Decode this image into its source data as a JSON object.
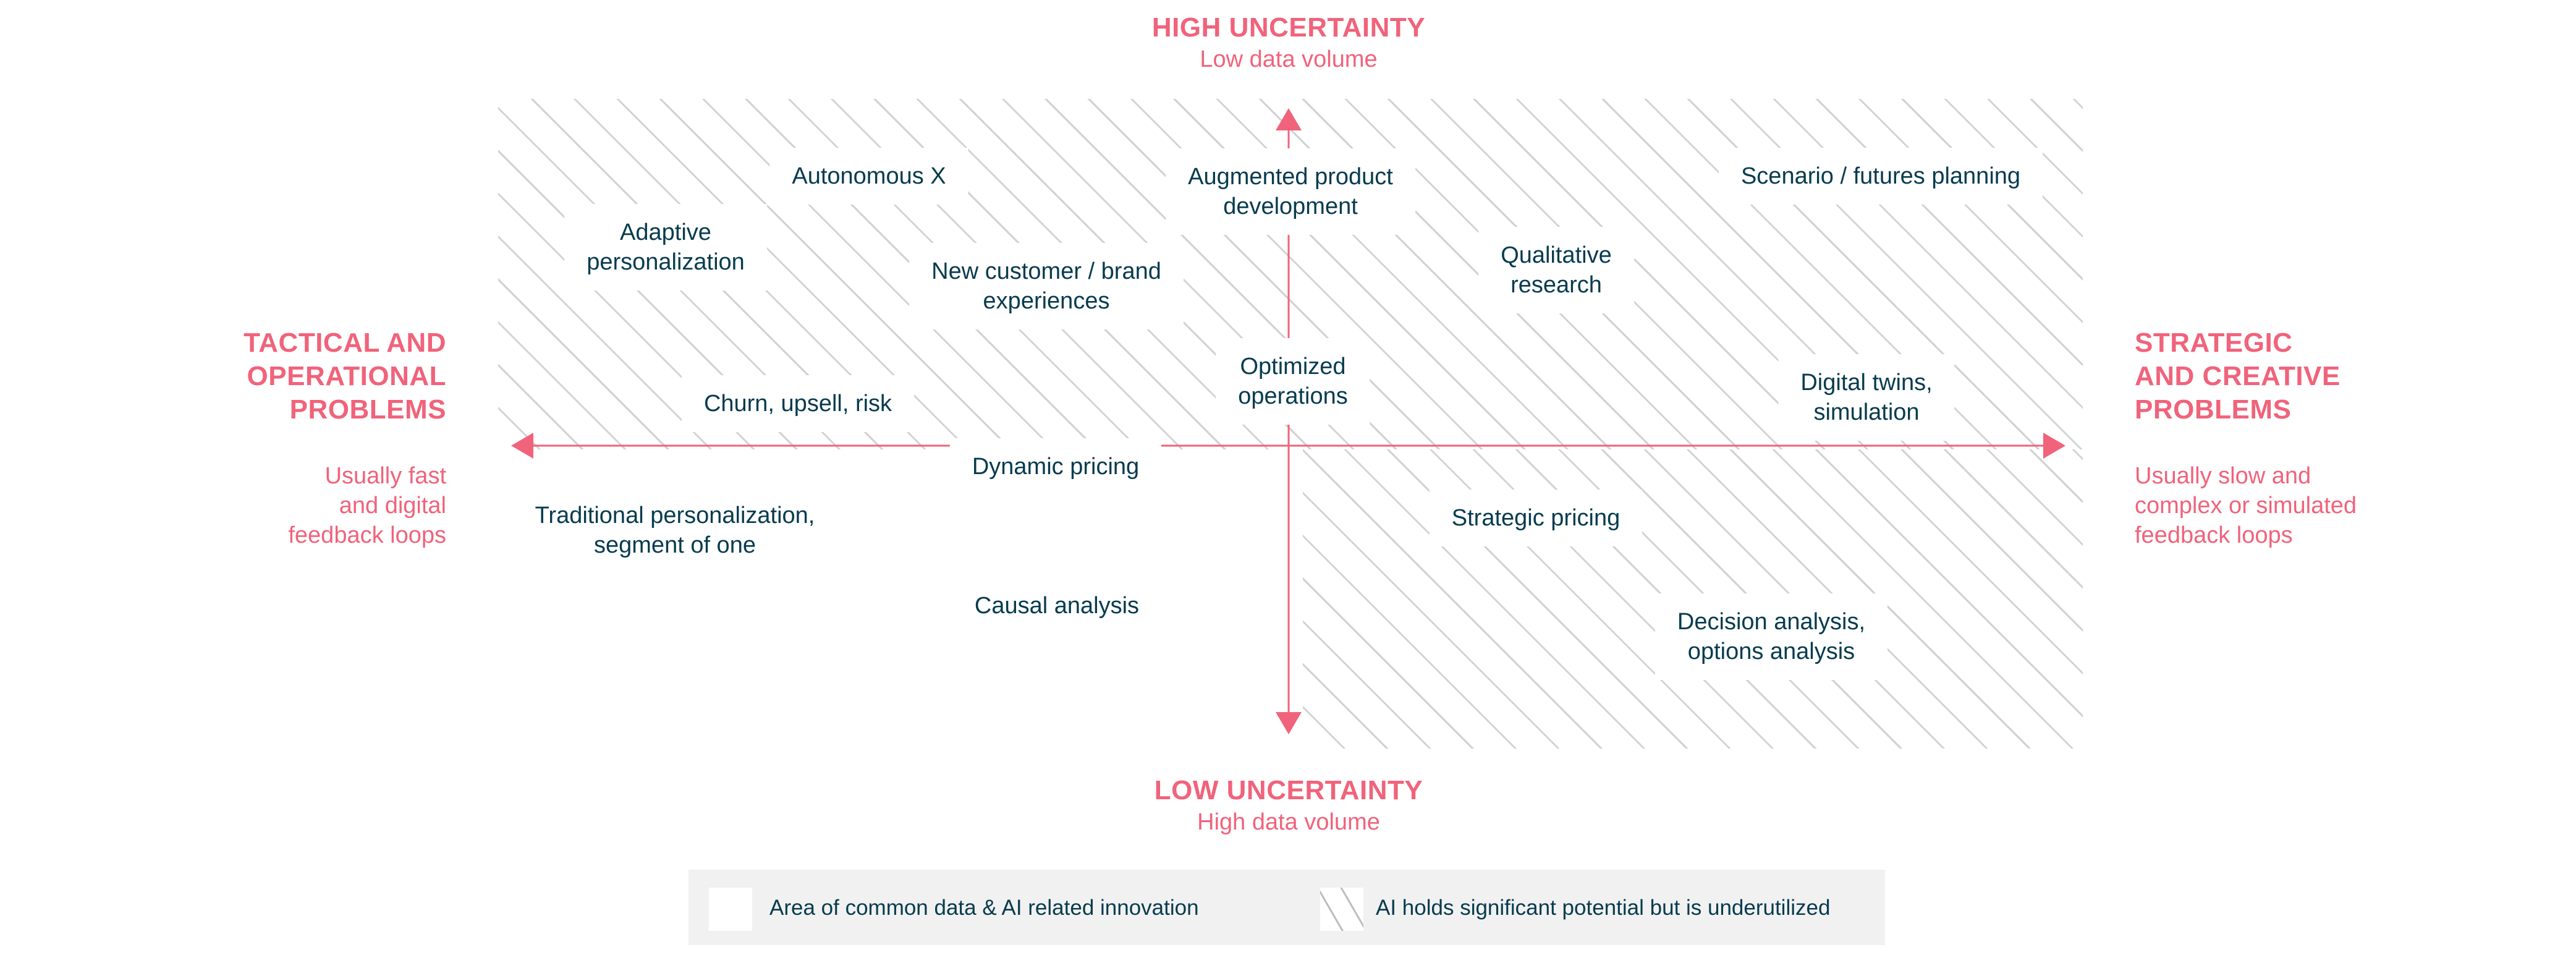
{
  "colors": {
    "accent": "#f0637b",
    "text": "#063b4e",
    "hatch": "#d2d2d2",
    "legend_bg": "#f1f1f1"
  },
  "axes": {
    "top": {
      "title": "HIGH UNCERTAINTY",
      "subtitle": "Low data volume"
    },
    "bottom": {
      "title": "LOW UNCERTAINTY",
      "subtitle": "High data volume"
    },
    "left": {
      "title_lines": [
        "TACTICAL AND",
        "OPERATIONAL",
        "PROBLEMS"
      ],
      "subtitle_lines": [
        "Usually fast",
        "and digital",
        "feedback loops"
      ]
    },
    "right": {
      "title_lines": [
        "STRATEGIC",
        "AND CREATIVE",
        "PROBLEMS"
      ],
      "subtitle_lines": [
        "Usually slow and",
        "complex or simulated",
        "feedback loops"
      ]
    }
  },
  "items": [
    {
      "id": "autonomous-x",
      "lines": [
        "Autonomous X"
      ],
      "quadrant": "top-left",
      "area": "hatched"
    },
    {
      "id": "adaptive-personalization",
      "lines": [
        "Adaptive",
        "personalization"
      ],
      "quadrant": "top-left",
      "area": "hatched"
    },
    {
      "id": "new-customer-brand-experiences",
      "lines": [
        "New customer / brand",
        "experiences"
      ],
      "quadrant": "top-left",
      "area": "hatched"
    },
    {
      "id": "churn-upsell-risk",
      "lines": [
        "Churn, upsell, risk"
      ],
      "quadrant": "top-left",
      "area": "hatched"
    },
    {
      "id": "augmented-product-development",
      "lines": [
        "Augmented product",
        "development"
      ],
      "quadrant": "top-center",
      "area": "hatched"
    },
    {
      "id": "optimized-operations",
      "lines": [
        "Optimized",
        "operations"
      ],
      "quadrant": "top-center",
      "area": "hatched"
    },
    {
      "id": "scenario-futures-planning",
      "lines": [
        "Scenario / futures planning"
      ],
      "quadrant": "top-right",
      "area": "hatched"
    },
    {
      "id": "qualitative-research",
      "lines": [
        "Qualitative",
        "research"
      ],
      "quadrant": "top-right",
      "area": "hatched"
    },
    {
      "id": "digital-twins-simulation",
      "lines": [
        "Digital twins,",
        "simulation"
      ],
      "quadrant": "top-right",
      "area": "hatched"
    },
    {
      "id": "dynamic-pricing",
      "lines": [
        "Dynamic pricing"
      ],
      "quadrant": "bottom-left",
      "area": "common"
    },
    {
      "id": "traditional-personalization",
      "lines": [
        "Traditional personalization,",
        "segment of one"
      ],
      "quadrant": "bottom-left",
      "area": "common"
    },
    {
      "id": "causal-analysis",
      "lines": [
        "Causal analysis"
      ],
      "quadrant": "bottom-left",
      "area": "common"
    },
    {
      "id": "strategic-pricing",
      "lines": [
        "Strategic pricing"
      ],
      "quadrant": "bottom-right",
      "area": "hatched"
    },
    {
      "id": "decision-analysis",
      "lines": [
        "Decision analysis,",
        "options analysis"
      ],
      "quadrant": "bottom-right",
      "area": "hatched"
    }
  ],
  "legend": [
    {
      "swatch": "plain-white",
      "label": "Area of common data & AI related innovation"
    },
    {
      "swatch": "hatched",
      "label": "AI holds significant potential but is underutilized"
    }
  ]
}
